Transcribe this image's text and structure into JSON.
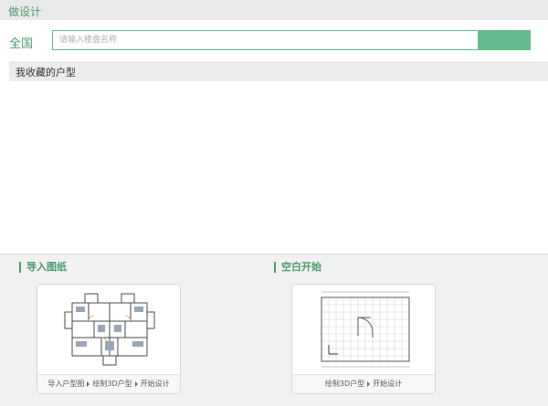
{
  "header": {
    "title": "做设计"
  },
  "search": {
    "region": "全国",
    "placeholder": "请输入楼盘名称",
    "value": ""
  },
  "favorites": {
    "title": "我收藏的户型"
  },
  "sections": [
    {
      "title": "导入图纸",
      "steps": [
        "导入户型图",
        "绘制3D户型",
        "开始设计"
      ]
    },
    {
      "title": "空白开始",
      "steps": [
        "绘制3D户型",
        "开始设计"
      ]
    }
  ],
  "colors": {
    "accent": "#4a9a6e",
    "search_button": "#62bc8b"
  },
  "icons": [
    "floorplan-thumbnail",
    "blank-grid-thumbnail",
    "caption-arrow-icon"
  ]
}
